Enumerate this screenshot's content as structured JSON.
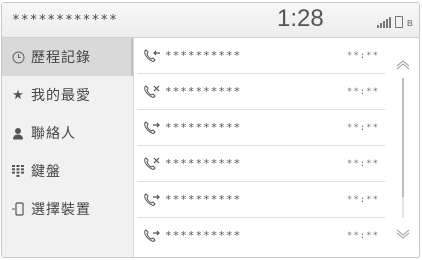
{
  "header": {
    "title": "************",
    "clock": "1:28"
  },
  "sidebar": {
    "items": [
      {
        "label": "歷程記錄",
        "icon": "clock-icon",
        "active": true
      },
      {
        "label": "我的最愛",
        "icon": "star-icon",
        "active": false
      },
      {
        "label": "聯絡人",
        "icon": "person-icon",
        "active": false
      },
      {
        "label": "鍵盤",
        "icon": "keypad-icon",
        "active": false
      },
      {
        "label": "選擇裝置",
        "icon": "phone-device-icon",
        "active": false
      }
    ]
  },
  "calls": [
    {
      "name": "**********",
      "time": "**:**",
      "type": "incoming"
    },
    {
      "name": "**********",
      "time": "**:**",
      "type": "missed"
    },
    {
      "name": "**********",
      "time": "**:**",
      "type": "outgoing"
    },
    {
      "name": "**********",
      "time": "**:**",
      "type": "missed"
    },
    {
      "name": "**********",
      "time": "**:**",
      "type": "outgoing"
    },
    {
      "name": "**********",
      "time": "**:**",
      "type": "outgoing"
    }
  ],
  "scroll": {
    "position": 0.0,
    "visible_fraction": 0.85
  },
  "colors": {
    "icon": "#555555",
    "active_bg": "#d9d9d9"
  }
}
